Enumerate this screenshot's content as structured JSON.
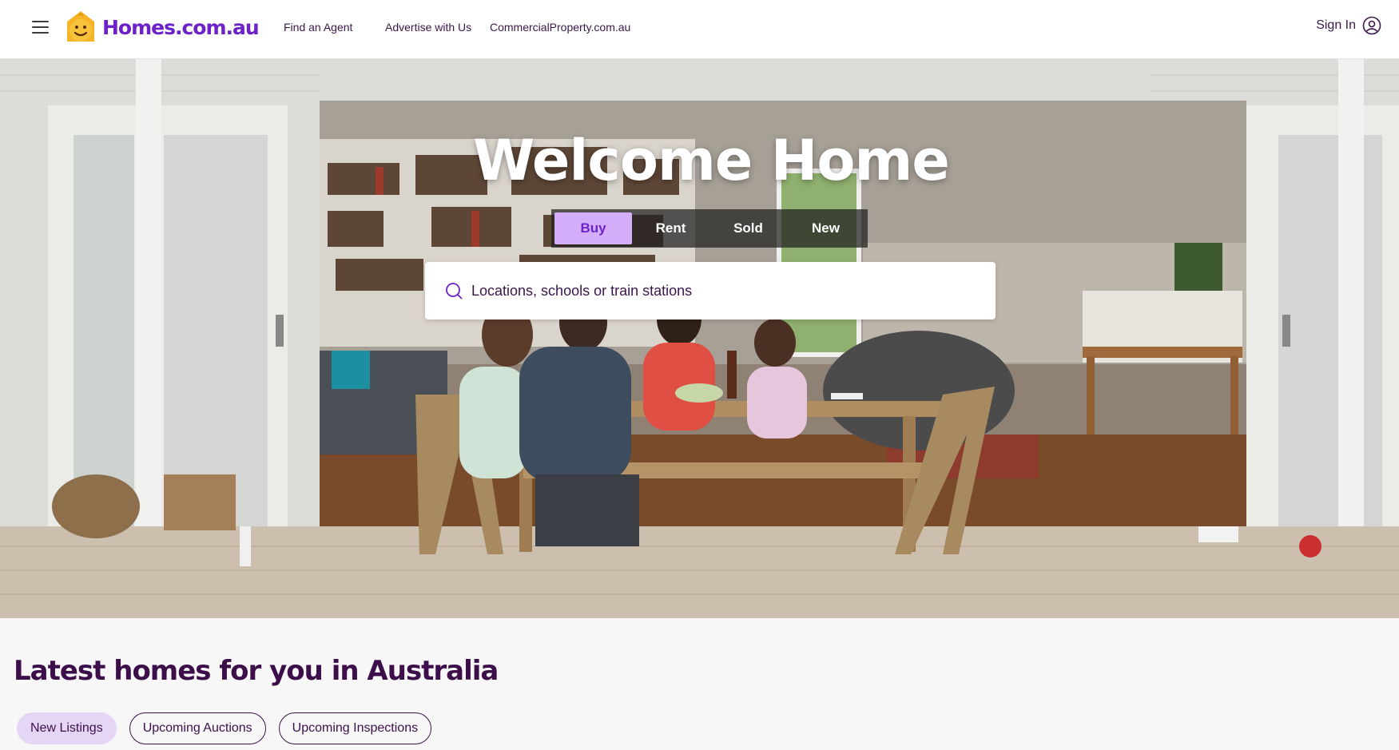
{
  "header": {
    "logo_text": "Homes.com.au",
    "nav": [
      "Find an Agent",
      "Advertise with Us",
      "CommercialProperty.com.au"
    ],
    "sign_in": "Sign In"
  },
  "hero": {
    "title": "Welcome Home",
    "tabs": [
      {
        "label": "Buy",
        "active": true
      },
      {
        "label": "Rent",
        "active": false
      },
      {
        "label": "Sold",
        "active": false
      },
      {
        "label": "New",
        "active": false
      }
    ],
    "search_placeholder": "Locations, schools or train stations"
  },
  "latest": {
    "title": "Latest homes for you in Australia",
    "chips": [
      {
        "label": "New Listings",
        "active": true
      },
      {
        "label": "Upcoming Auctions",
        "active": false
      },
      {
        "label": "Upcoming Inspections",
        "active": false
      }
    ]
  },
  "colors": {
    "brand_purple": "#6d22c9",
    "logo_yellow": "#f5b526",
    "tab_active_bg": "#d4aefb",
    "text_dark": "#3c0f4b"
  }
}
